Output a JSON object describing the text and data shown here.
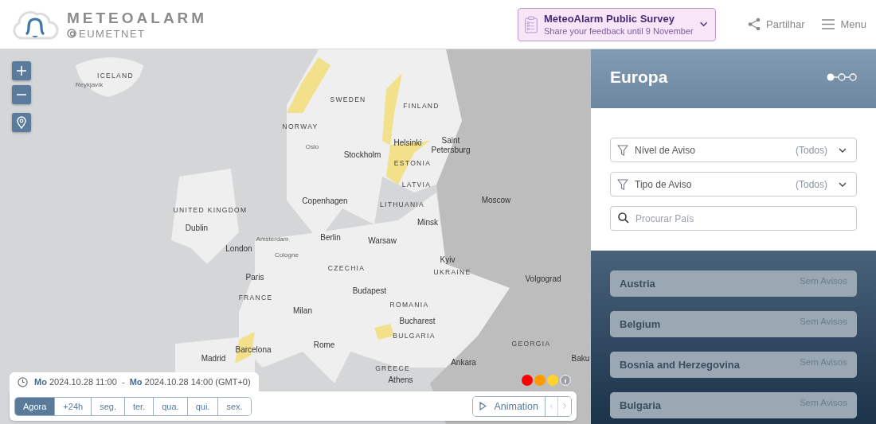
{
  "header": {
    "logo": {
      "title": "METEOALARM",
      "subtitle": "EUMETNET"
    },
    "survey": {
      "title": "MeteoAlarm Public Survey",
      "subtitle": "Share your feedback until 9 November"
    },
    "share": "Partilhar",
    "menu": "Menu"
  },
  "map": {
    "labels": [
      {
        "text": "ICELAND",
        "kind": "country"
      },
      {
        "text": "Reykjavík",
        "kind": "minor"
      },
      {
        "text": "SWEDEN",
        "kind": "country"
      },
      {
        "text": "FINLAND",
        "kind": "country"
      },
      {
        "text": "NORWAY",
        "kind": "country"
      },
      {
        "text": "Oslo",
        "kind": "minor"
      },
      {
        "text": "Helsinki",
        "kind": "city"
      },
      {
        "text": "Saint Petersburg",
        "kind": "city"
      },
      {
        "text": "Stockholm",
        "kind": "city"
      },
      {
        "text": "ESTONIA",
        "kind": "country"
      },
      {
        "text": "LATVIA",
        "kind": "country"
      },
      {
        "text": "Copenhagen",
        "kind": "city"
      },
      {
        "text": "LITHUANIA",
        "kind": "country"
      },
      {
        "text": "Moscow",
        "kind": "city"
      },
      {
        "text": "UNITED KINGDOM",
        "kind": "country"
      },
      {
        "text": "Minsk",
        "kind": "city"
      },
      {
        "text": "Dublin",
        "kind": "city"
      },
      {
        "text": "Amsterdam",
        "kind": "minor"
      },
      {
        "text": "Berlin",
        "kind": "city"
      },
      {
        "text": "Warsaw",
        "kind": "city"
      },
      {
        "text": "London",
        "kind": "city"
      },
      {
        "text": "Cologne",
        "kind": "minor"
      },
      {
        "text": "Kyiv",
        "kind": "city"
      },
      {
        "text": "UKRAINE",
        "kind": "country"
      },
      {
        "text": "CZECHIA",
        "kind": "country"
      },
      {
        "text": "Paris",
        "kind": "city"
      },
      {
        "text": "Volgograd",
        "kind": "city"
      },
      {
        "text": "Budapest",
        "kind": "city"
      },
      {
        "text": "FRANCE",
        "kind": "country"
      },
      {
        "text": "ROMANIA",
        "kind": "country"
      },
      {
        "text": "Milan",
        "kind": "city"
      },
      {
        "text": "Bucharest",
        "kind": "city"
      },
      {
        "text": "BULGARIA",
        "kind": "country"
      },
      {
        "text": "Rome",
        "kind": "city"
      },
      {
        "text": "GEORGIA",
        "kind": "country"
      },
      {
        "text": "Barcelona",
        "kind": "city"
      },
      {
        "text": "Baku",
        "kind": "city"
      },
      {
        "text": "Madrid",
        "kind": "city"
      },
      {
        "text": "Ankara",
        "kind": "city"
      },
      {
        "text": "GREECE",
        "kind": "country"
      },
      {
        "text": "Athens",
        "kind": "city"
      }
    ],
    "legend": [
      {
        "color": "#ff0000"
      },
      {
        "color": "#ff9900"
      },
      {
        "color": "#ffd22e"
      }
    ]
  },
  "timebar": {
    "from_day": "Mo",
    "from": "2024.10.28 11:00",
    "separator": "-",
    "to_day": "Mo",
    "to": "2024.10.28 14:00 (GMT+0)",
    "tabs": [
      {
        "label": "Agora",
        "selected": true
      },
      {
        "label": "+24h",
        "selected": false
      },
      {
        "label": "seg.",
        "selected": false
      },
      {
        "label": "ter.",
        "selected": false
      },
      {
        "label": "qua.",
        "selected": false
      },
      {
        "label": "qui.",
        "selected": false
      },
      {
        "label": "sex.",
        "selected": false
      }
    ],
    "animation": "Animation"
  },
  "sidebar": {
    "title": "Europa",
    "filters": [
      {
        "label": "Nível de Aviso",
        "value": "(Todos)"
      },
      {
        "label": "Tipo de Aviso",
        "value": "(Todos)"
      }
    ],
    "search": {
      "placeholder": "Procurar País"
    },
    "countries": [
      {
        "name": "Austria",
        "status": "Sem Avisos"
      },
      {
        "name": "Belgium",
        "status": "Sem Avisos"
      },
      {
        "name": "Bosnia and Herzegovina",
        "status": "Sem Avisos"
      },
      {
        "name": "Bulgaria",
        "status": "Sem Avisos"
      }
    ]
  }
}
